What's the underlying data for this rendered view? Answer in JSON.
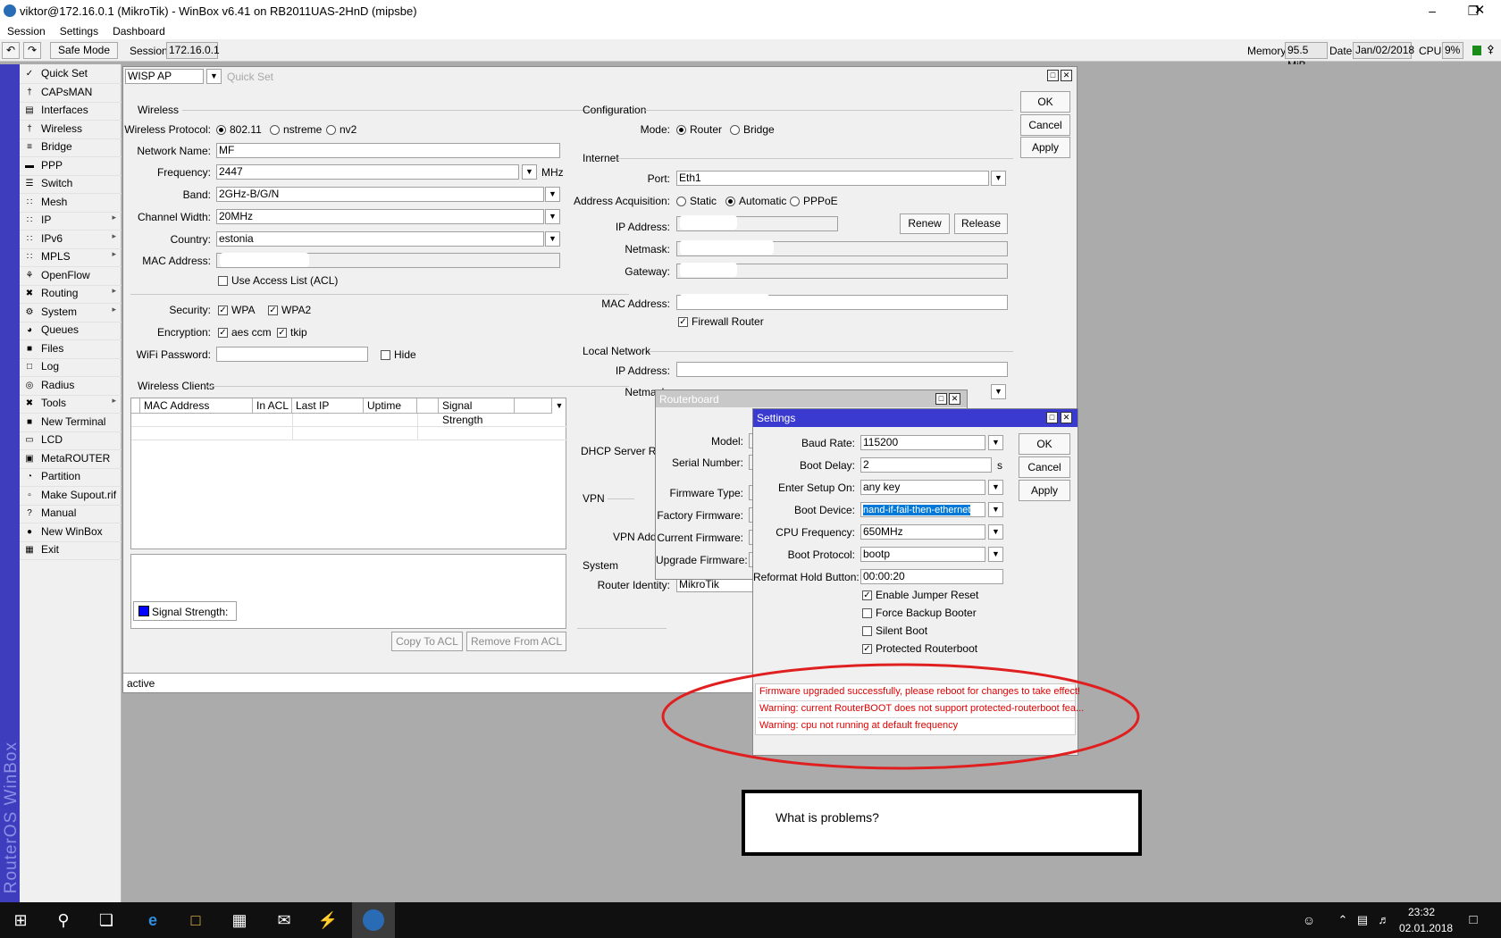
{
  "window": {
    "title": "viktor@172.16.0.1 (MikroTik) - WinBox v6.41 on RB2011UAS-2HnD (mipsbe)"
  },
  "menu": [
    "Session",
    "Settings",
    "Dashboard"
  ],
  "toolbar": {
    "safe_mode": "Safe Mode",
    "session_label": "Session:",
    "session_value": "172.16.0.1",
    "memory_label": "Memory:",
    "memory_value": "95.5 MiB",
    "date_label": "Date:",
    "date_value": "Jan/02/2018",
    "cpu_label": "CPU:",
    "cpu_value": "9%"
  },
  "brand_vertical": "RouterOS WinBox",
  "sidebar": [
    {
      "label": "Quick Set",
      "icon": "quickset-icon",
      "arrow": false
    },
    {
      "label": "CAPsMAN",
      "icon": "capsman-icon",
      "arrow": false
    },
    {
      "label": "Interfaces",
      "icon": "interfaces-icon",
      "arrow": false
    },
    {
      "label": "Wireless",
      "icon": "wireless-icon",
      "arrow": false
    },
    {
      "label": "Bridge",
      "icon": "bridge-icon",
      "arrow": false
    },
    {
      "label": "PPP",
      "icon": "ppp-icon",
      "arrow": false
    },
    {
      "label": "Switch",
      "icon": "switch-icon",
      "arrow": false
    },
    {
      "label": "Mesh",
      "icon": "mesh-icon",
      "arrow": false
    },
    {
      "label": "IP",
      "icon": "ip-icon",
      "arrow": true
    },
    {
      "label": "IPv6",
      "icon": "ipv6-icon",
      "arrow": true
    },
    {
      "label": "MPLS",
      "icon": "mpls-icon",
      "arrow": true
    },
    {
      "label": "OpenFlow",
      "icon": "openflow-icon",
      "arrow": false
    },
    {
      "label": "Routing",
      "icon": "routing-icon",
      "arrow": true
    },
    {
      "label": "System",
      "icon": "system-icon",
      "arrow": true
    },
    {
      "label": "Queues",
      "icon": "queues-icon",
      "arrow": false
    },
    {
      "label": "Files",
      "icon": "files-icon",
      "arrow": false
    },
    {
      "label": "Log",
      "icon": "log-icon",
      "arrow": false
    },
    {
      "label": "Radius",
      "icon": "radius-icon",
      "arrow": false
    },
    {
      "label": "Tools",
      "icon": "tools-icon",
      "arrow": true
    },
    {
      "label": "New Terminal",
      "icon": "terminal-icon",
      "arrow": false
    },
    {
      "label": "LCD",
      "icon": "lcd-icon",
      "arrow": false
    },
    {
      "label": "MetaROUTER",
      "icon": "metarouter-icon",
      "arrow": false
    },
    {
      "label": "Partition",
      "icon": "partition-icon",
      "arrow": false
    },
    {
      "label": "Make Supout.rif",
      "icon": "supout-icon",
      "arrow": false
    },
    {
      "label": "Manual",
      "icon": "manual-icon",
      "arrow": false
    },
    {
      "label": "New WinBox",
      "icon": "winbox-icon",
      "arrow": false
    },
    {
      "label": "Exit",
      "icon": "exit-icon",
      "arrow": false
    }
  ],
  "quickset": {
    "mode_value": "WISP AP",
    "title": "Quick Set",
    "buttons": {
      "ok": "OK",
      "cancel": "Cancel",
      "apply": "Apply"
    },
    "wireless": {
      "section": "Wireless",
      "protocol_label": "Wireless Protocol:",
      "protocol_options": [
        "802.11",
        "nstreme",
        "nv2"
      ],
      "network_name_label": "Network Name:",
      "network_name": "MF",
      "frequency_label": "Frequency:",
      "frequency": "2447",
      "frequency_unit": "MHz",
      "band_label": "Band:",
      "band": "2GHz-B/G/N",
      "channel_width_label": "Channel Width:",
      "channel_width": "20MHz",
      "country_label": "Country:",
      "country": "estonia",
      "mac_label": "MAC Address:",
      "acl_label": "Use Access List (ACL)",
      "security_label": "Security:",
      "wpa": "WPA",
      "wpa2": "WPA2",
      "encryption_label": "Encryption:",
      "aes": "aes ccm",
      "tkip": "tkip",
      "password_label": "WiFi Password:",
      "hide": "Hide"
    },
    "clients": {
      "section": "Wireless Clients",
      "columns": [
        "MAC Address",
        "In ACL",
        "Last IP",
        "Uptime",
        "",
        "Signal Strength"
      ],
      "signal_legend": "Signal Strength:",
      "copy_acl": "Copy To ACL",
      "remove_acl": "Remove From ACL"
    },
    "configuration": {
      "section": "Configuration",
      "mode_label": "Mode:",
      "router": "Router",
      "bridge": "Bridge"
    },
    "internet": {
      "section": "Internet",
      "port_label": "Port:",
      "port": "Eth1",
      "acq_label": "Address Acquisition:",
      "static": "Static",
      "automatic": "Automatic",
      "pppoe": "PPPoE",
      "ip_label": "IP Address:",
      "renew": "Renew",
      "release": "Release",
      "netmask_label": "Netmask:",
      "gateway_label": "Gateway:",
      "mac_label": "MAC Address:",
      "firewall": "Firewall Router"
    },
    "local": {
      "section": "Local Network",
      "ip_label": "IP Address:",
      "netmask_label": "Netmask:",
      "dhcp_label": "DHCP Server Range:"
    },
    "vpn": {
      "section": "VPN",
      "address_label": "VPN Address:"
    },
    "system": {
      "section": "System",
      "identity_label": "Router Identity:",
      "identity": "MikroTik"
    },
    "status": "active"
  },
  "routerboard": {
    "title": "Routerboard",
    "model_label": "Model:",
    "serial_label": "Serial Number:",
    "fw_type_label": "Firmware Type:",
    "factory_label": "Factory Firmware:",
    "current_label": "Current Firmware:",
    "upgrade_label": "Upgrade Firmware:"
  },
  "settings": {
    "title": "Settings",
    "buttons": {
      "ok": "OK",
      "cancel": "Cancel",
      "apply": "Apply"
    },
    "baud_label": "Baud Rate:",
    "baud": "115200",
    "delay_label": "Boot Delay:",
    "delay": "2",
    "delay_unit": "s",
    "setup_label": "Enter Setup On:",
    "setup": "any key",
    "device_label": "Boot Device:",
    "device": "nand-if-fail-then-ethernet",
    "cpu_label": "CPU Frequency:",
    "cpu": "650MHz",
    "protocol_label": "Boot Protocol:",
    "protocol": "bootp",
    "reformat_label": "Reformat Hold Button:",
    "reformat": "00:00:20",
    "checks": [
      {
        "label": "Enable Jumper Reset",
        "checked": true
      },
      {
        "label": "Force Backup Booter",
        "checked": false
      },
      {
        "label": "Silent Boot",
        "checked": false
      },
      {
        "label": "Protected Routerboot",
        "checked": true
      }
    ],
    "messages": [
      "Firmware upgraded successfully, please reboot for changes to take effect!",
      "Warning: current RouterBOOT does not support protected-routerboot fea...",
      "Warning: cpu not running at default frequency"
    ]
  },
  "annotation": {
    "question": "What is problems?"
  },
  "taskbar": {
    "time": "23:32",
    "date": "02.01.2018"
  },
  "colors": {
    "sidebar_strip": "#3d3dbd",
    "highlight": "#0078d7",
    "warning": "#e00000",
    "ellipse": "#e02020"
  }
}
